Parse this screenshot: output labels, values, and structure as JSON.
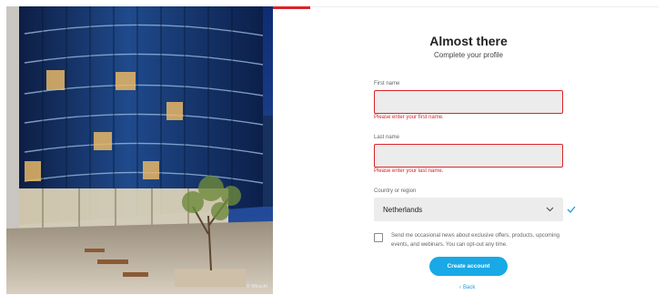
{
  "photo": {
    "credit": "© Mirachi"
  },
  "heading": {
    "title": "Almost there",
    "subtitle": "Complete your profile"
  },
  "form": {
    "first_name": {
      "label": "First name",
      "value": "",
      "error": "Please enter your first name."
    },
    "last_name": {
      "label": "Last name",
      "value": "",
      "error": "Please enter your last name."
    },
    "country": {
      "label": "Country or region",
      "selected": "Netherlands",
      "valid": true
    },
    "consent": {
      "checked": false,
      "text": "Send me occasional news about exclusive offers, products, upcoming events, and webinars. You can opt-out any time."
    },
    "create_button": "Create account",
    "back_link": "Back"
  },
  "colors": {
    "accent_red": "#d9252a",
    "button_blue": "#18a9e6",
    "link_blue": "#1a9fdd",
    "field_bg": "#ececec",
    "check_blue": "#1aa0dc"
  },
  "icons": {
    "select_caret": "chevron-down-icon",
    "country_valid": "checkmark-icon",
    "back_arrow": "chevron-left-icon"
  }
}
